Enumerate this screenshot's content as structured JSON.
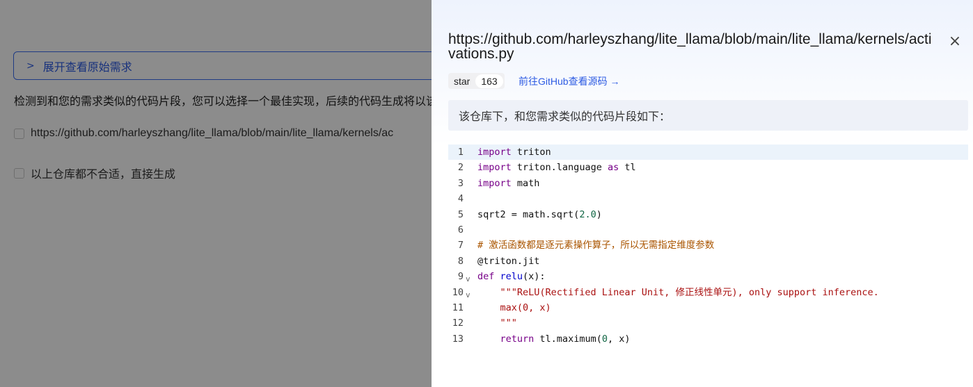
{
  "background": {
    "expand_label": "展开查看原始需求",
    "hint": "检测到和您的需求类似的代码片段，您可以选择一个最佳实现，后续的代码生成将以该",
    "options": [
      "https://github.com/harleyszhang/lite_llama/blob/main/lite_llama/kernels/ac",
      "以上仓库都不合适，直接生成"
    ]
  },
  "drawer": {
    "title": "https://github.com/harleyszhang/lite_llama/blob/main/lite_llama/kernels/activations.py",
    "close_icon": "×",
    "star_label": "star",
    "star_count": "163",
    "github_link": "前往GitHub查看源码 →",
    "info": "该仓库下，和您需求类似的代码片段如下：",
    "code": {
      "line_numbers": [
        "1",
        "2",
        "3",
        "4",
        "5",
        "6",
        "7",
        "8",
        "9",
        "10",
        "11",
        "12",
        "13"
      ],
      "lines": [
        [
          {
            "t": "import",
            "c": "kw"
          },
          {
            "t": " triton",
            "c": ""
          }
        ],
        [
          {
            "t": "import",
            "c": "kw"
          },
          {
            "t": " triton.language ",
            "c": ""
          },
          {
            "t": "as",
            "c": "kw"
          },
          {
            "t": " tl",
            "c": ""
          }
        ],
        [
          {
            "t": "import",
            "c": "kw"
          },
          {
            "t": " math",
            "c": ""
          }
        ],
        [],
        [
          {
            "t": "sqrt2 = math.sqrt(",
            "c": ""
          },
          {
            "t": "2.0",
            "c": "num"
          },
          {
            "t": ")",
            "c": ""
          }
        ],
        [],
        [
          {
            "t": "# 激活函数都是逐元素操作算子，所以无需指定维度参数",
            "c": "cm"
          }
        ],
        [
          {
            "t": "@triton.jit",
            "c": ""
          }
        ],
        [
          {
            "t": "def",
            "c": "kw"
          },
          {
            "t": " ",
            "c": ""
          },
          {
            "t": "relu",
            "c": "fn"
          },
          {
            "t": "(x):",
            "c": ""
          }
        ],
        [
          {
            "t": "    \"\"\"ReLU(Rectified Linear Unit, 修正线性单元), only support inference.",
            "c": "str"
          }
        ],
        [
          {
            "t": "    max(0, x)",
            "c": "str"
          }
        ],
        [
          {
            "t": "    \"\"\"",
            "c": "str"
          }
        ],
        [
          {
            "t": "    ",
            "c": ""
          },
          {
            "t": "return",
            "c": "kw"
          },
          {
            "t": " tl.maximum(",
            "c": ""
          },
          {
            "t": "0",
            "c": "num"
          },
          {
            "t": ", x)",
            "c": ""
          }
        ]
      ],
      "foldable_lines": [
        9,
        10
      ]
    }
  }
}
